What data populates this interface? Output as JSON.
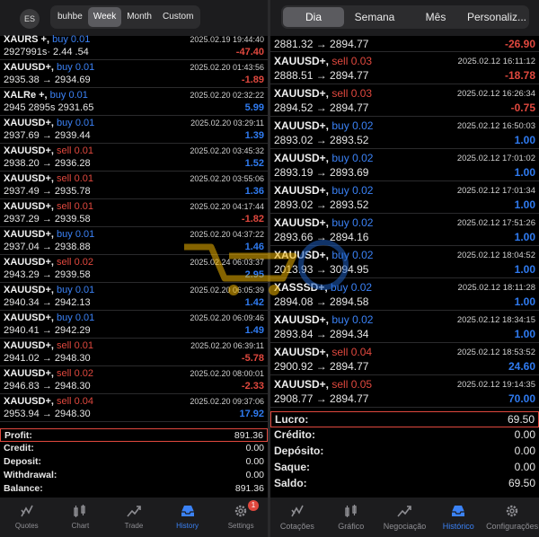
{
  "left": {
    "avatar": "ES",
    "segments": [
      "buhbe",
      "Week",
      "Month",
      "Custom"
    ],
    "active_segment": 1,
    "deals": [
      {
        "symbol": "XAURS +,",
        "side": "buy",
        "lot": "0.01",
        "time": "2025.02.19 19:44:40",
        "prices": "2927991s·  2.44 .54",
        "pnl": "-47.40"
      },
      {
        "symbol": "XAUUSD+,",
        "side": "buy",
        "lot": "0.01",
        "time": "2025.02.20 01:43:56",
        "prices": "2935.38 → 2934.69",
        "pnl": "-1.89"
      },
      {
        "symbol": "XALRe +,",
        "side": "buy",
        "lot": "0.01",
        "time": "2025.02.20 02:32:22",
        "prices": "2945 2895s  2931.65",
        "pnl": "5.99"
      },
      {
        "symbol": "XAUUSD+,",
        "side": "buy",
        "lot": "0.01",
        "time": "2025.02.20 03:29:11",
        "prices": "2937.69 → 2939.44",
        "pnl": "1.39"
      },
      {
        "symbol": "XAUUSD+,",
        "side": "sell",
        "lot": "0.01",
        "time": "2025.02.20 03:45:32",
        "prices": "2938.20 → 2936.28",
        "pnl": "1.52"
      },
      {
        "symbol": "XAUUSD+,",
        "side": "sell",
        "lot": "0.01",
        "time": "2025.02.20 03:55:06",
        "prices": "2937.49 → 2935.78",
        "pnl": "1.36"
      },
      {
        "symbol": "XAUUSD+,",
        "side": "sell",
        "lot": "0.01",
        "time": "2025.02.20 04:17:44",
        "prices": "2937.29 → 2939.58",
        "pnl": "-1.82"
      },
      {
        "symbol": "XAUUSD+,",
        "side": "buy",
        "lot": "0.01",
        "time": "2025.02.20 04:37:22",
        "prices": "2937.04 → 2938.88",
        "pnl": "1.46"
      },
      {
        "symbol": "XAUUSD+,",
        "side": "sell",
        "lot": "0.02",
        "time": "2025.02.24 06:03:37",
        "prices": "2943.29 → 2939.58",
        "pnl": "2.95"
      },
      {
        "symbol": "XAUUSD+,",
        "side": "buy",
        "lot": "0.01",
        "time": "2025.02.20 06:05:39",
        "prices": "2940.34 → 2942.13",
        "pnl": "1.42"
      },
      {
        "symbol": "XAUUSD+,",
        "side": "buy",
        "lot": "0.01",
        "time": "2025.02.20 06:09:46",
        "prices": "2940.41 → 2942.29",
        "pnl": "1.49"
      },
      {
        "symbol": "XAUUSD+,",
        "side": "sell",
        "lot": "0.01",
        "time": "2025.02.20 06:39:11",
        "prices": "2941.02 → 2948.30",
        "pnl": "-5.78"
      },
      {
        "symbol": "XAUUSD+,",
        "side": "sell",
        "lot": "0.02",
        "time": "2025.02.20 08:00:01",
        "prices": "2946.83 → 2948.30",
        "pnl": "-2.33"
      },
      {
        "symbol": "XAUUSD+,",
        "side": "sell",
        "lot": "0.04",
        "time": "2025.02.20 09:37:06",
        "prices": "2953.94 → 2948.30",
        "pnl": "17.92"
      }
    ],
    "summary": [
      {
        "label": "Profit:",
        "value": "891.36",
        "highlight": true
      },
      {
        "label": "Credit:",
        "value": "0.00"
      },
      {
        "label": "Deposit:",
        "value": "0.00"
      },
      {
        "label": "Withdrawal:",
        "value": "0.00"
      },
      {
        "label": "Balance:",
        "value": "891.36"
      }
    ],
    "tabs": [
      {
        "label": "Quotes",
        "icon": "quotes-icon"
      },
      {
        "label": "Chart",
        "icon": "chart-icon"
      },
      {
        "label": "Trade",
        "icon": "trade-icon"
      },
      {
        "label": "History",
        "icon": "history-icon",
        "active": true
      },
      {
        "label": "Settings",
        "icon": "settings-icon",
        "badge": "1"
      }
    ]
  },
  "right": {
    "segments": [
      "Dia",
      "Semana",
      "Mês",
      "Personaliz..."
    ],
    "active_segment": 0,
    "top_partial": {
      "prices": "2881.32 → 2894.77",
      "pnl": "-26.90"
    },
    "deals": [
      {
        "symbol": "XAUUSD+,",
        "side": "sell",
        "lot": "0.03",
        "time": "2025.02.12 16:11:12",
        "prices": "2888.51 → 2894.77",
        "pnl": "-18.78"
      },
      {
        "symbol": "XAUUSD+,",
        "side": "sell",
        "lot": "0.03",
        "time": "2025.02.12 16:26:34",
        "prices": "2894.52 → 2894.77",
        "pnl": "-0.75"
      },
      {
        "symbol": "XAUUSD+,",
        "side": "buy",
        "lot": "0.02",
        "time": "2025.02.12 16:50:03",
        "prices": "2893.02 → 2893.52",
        "pnl": "1.00"
      },
      {
        "symbol": "XAUUSD+,",
        "side": "buy",
        "lot": "0.02",
        "time": "2025.02.12 17:01:02",
        "prices": "2893.19 → 2893.69",
        "pnl": "1.00"
      },
      {
        "symbol": "XAUUSD+,",
        "side": "buy",
        "lot": "0.02",
        "time": "2025.02.12 17:01:34",
        "prices": "2893.02 → 2893.52",
        "pnl": "1.00"
      },
      {
        "symbol": "XAUUSD+,",
        "side": "buy",
        "lot": "0.02",
        "time": "2025.02.12 17:51:26",
        "prices": "2893.66 → 2894.16",
        "pnl": "1.00"
      },
      {
        "symbol": "XAUUSD+,",
        "side": "buy",
        "lot": "0.02",
        "time": "2025.02.12 18:04:52",
        "prices": "2013.93 → 3094.95",
        "pnl": "1.00"
      },
      {
        "symbol": "XASSSD+,",
        "side": "buy",
        "lot": "0.02",
        "time": "2025.02.12 18:11:28",
        "prices": "2894.08 → 2894.58",
        "pnl": "1.00"
      },
      {
        "symbol": "XAUUSD+,",
        "side": "buy",
        "lot": "0.02",
        "time": "2025.02.12 18:34:15",
        "prices": "2893.84 → 2894.34",
        "pnl": "1.00"
      },
      {
        "symbol": "XAUUSD+,",
        "side": "sell",
        "lot": "0.04",
        "time": "2025.02.12 18:53:52",
        "prices": "2900.92 → 2894.77",
        "pnl": "24.60"
      },
      {
        "symbol": "XAUUSD+,",
        "side": "sell",
        "lot": "0.05",
        "time": "2025.02.12 19:14:35",
        "prices": "2908.77 → 2894.77",
        "pnl": "70.00"
      }
    ],
    "summary": [
      {
        "label": "Lucro:",
        "value": "69.50",
        "highlight": true
      },
      {
        "label": "Crédito:",
        "value": "0.00"
      },
      {
        "label": "Depósito:",
        "value": "0.00"
      },
      {
        "label": "Saque:",
        "value": "0.00"
      },
      {
        "label": "Saldo:",
        "value": "69.50"
      }
    ],
    "tabs": [
      {
        "label": "Cotações",
        "icon": "quotes-icon"
      },
      {
        "label": "Gráfico",
        "icon": "chart-icon"
      },
      {
        "label": "Negociação",
        "icon": "trade-icon"
      },
      {
        "label": "Histórico",
        "icon": "history-icon",
        "active": true
      },
      {
        "label": "Configurações",
        "icon": "settings-icon"
      }
    ]
  },
  "colors": {
    "buy": "#3b82f6",
    "sell": "#e0483e",
    "accent": "#3b82f6",
    "highlight_border": "#e0483e"
  }
}
